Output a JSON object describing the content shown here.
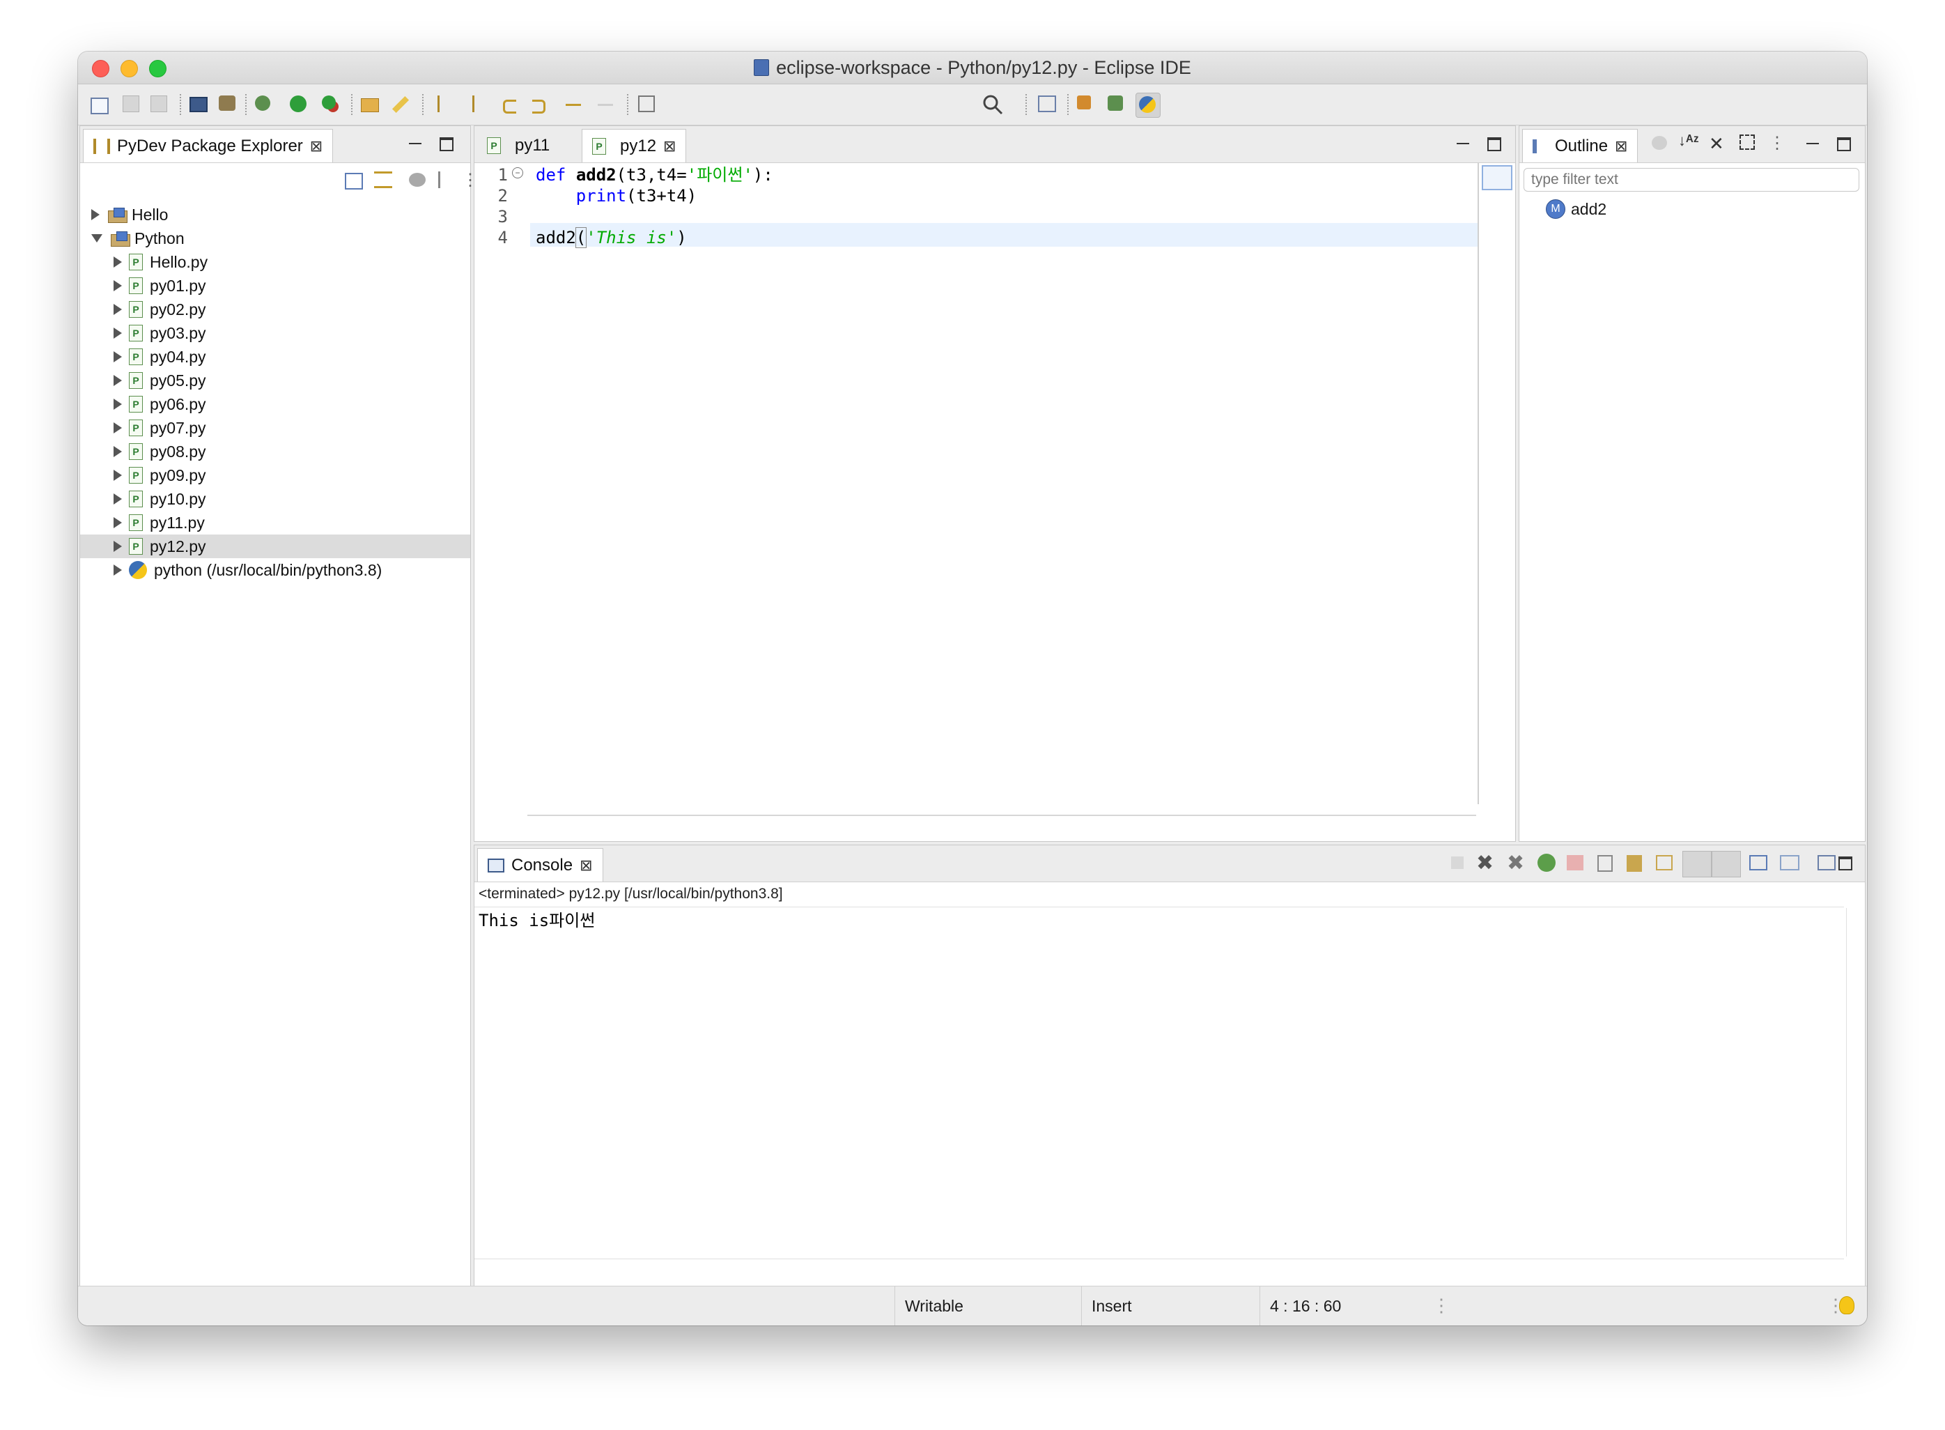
{
  "window": {
    "title": "eclipse-workspace - Python/py12.py - Eclipse IDE"
  },
  "colors": {
    "keyword": "#0000ff",
    "string": "#00aa00",
    "current_line": "#e8f2fe",
    "selection": "#dcdcdc"
  },
  "explorer": {
    "tab_label": "PyDev Package Explorer",
    "items": [
      {
        "label": "Hello",
        "type": "project",
        "expanded": false
      },
      {
        "label": "Python",
        "type": "project",
        "expanded": true
      },
      {
        "label": "Hello.py",
        "type": "file"
      },
      {
        "label": "py01.py",
        "type": "file"
      },
      {
        "label": "py02.py",
        "type": "file"
      },
      {
        "label": "py03.py",
        "type": "file"
      },
      {
        "label": "py04.py",
        "type": "file"
      },
      {
        "label": "py05.py",
        "type": "file"
      },
      {
        "label": "py06.py",
        "type": "file"
      },
      {
        "label": "py07.py",
        "type": "file"
      },
      {
        "label": "py08.py",
        "type": "file"
      },
      {
        "label": "py09.py",
        "type": "file"
      },
      {
        "label": "py10.py",
        "type": "file"
      },
      {
        "label": "py11.py",
        "type": "file"
      },
      {
        "label": "py12.py",
        "type": "file",
        "selected": true
      },
      {
        "label": "python  (/usr/local/bin/python3.8)",
        "type": "interpreter"
      }
    ]
  },
  "editor": {
    "tabs": [
      {
        "label": "py11",
        "active": false
      },
      {
        "label": "py12",
        "active": true
      }
    ],
    "line_numbers": [
      "1",
      "2",
      "3",
      "4"
    ],
    "lines": [
      {
        "t1": "def",
        "t2": " ",
        "t3": "add2",
        "t4": "(t3,t4=",
        "t5": "'파이썬'",
        "t6": "):"
      },
      {
        "t1": "    ",
        "t2": "print",
        "t3": "(t3+t4)"
      },
      {
        "t1": ""
      },
      {
        "t1": "add2",
        "t2": "(",
        "t3": "'This is'",
        "t4": ")"
      }
    ]
  },
  "outline": {
    "tab_label": "Outline",
    "filter_placeholder": "type filter text",
    "items": [
      {
        "label": "add2",
        "icon": "method-icon"
      }
    ]
  },
  "console": {
    "tab_label": "Console",
    "header": "<terminated> py12.py [/usr/local/bin/python3.8]",
    "output": "This is파이썬"
  },
  "statusbar": {
    "writable": "Writable",
    "mode": "Insert",
    "position": "4 : 16 : 60"
  }
}
